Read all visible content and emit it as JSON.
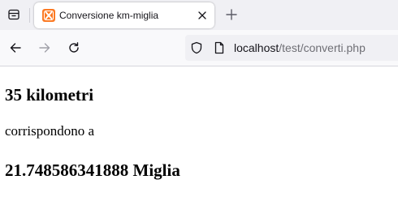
{
  "browser": {
    "tab": {
      "title": "Conversione km-miglia",
      "favicon_color": "#fb7a24"
    },
    "address": {
      "host": "localhost",
      "path": "/test/converti.php"
    },
    "icons": {
      "tab_list": "tab-list-icon",
      "close": "close-icon",
      "new_tab": "plus-icon",
      "back": "arrow-left-icon",
      "forward": "arrow-right-icon",
      "reload": "reload-icon",
      "security": "shield-icon",
      "page_info": "page-icon"
    }
  },
  "page": {
    "heading_top": "35 kilometri",
    "middle_text": "corrispondono a",
    "heading_bottom": "21.748586341888 Miglia"
  }
}
